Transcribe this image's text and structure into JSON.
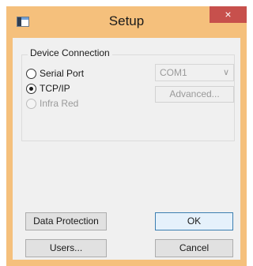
{
  "window": {
    "title": "Setup",
    "close_label": "×"
  },
  "device_connection": {
    "group_label": "Device Connection",
    "options": [
      {
        "label": "Serial Port",
        "selected": false,
        "enabled": true
      },
      {
        "label": "TCP/IP",
        "selected": true,
        "enabled": true
      },
      {
        "label": "Infra Red",
        "selected": false,
        "enabled": false
      }
    ],
    "port_select": {
      "value": "COM1",
      "enabled": false
    },
    "advanced_label": "Advanced..."
  },
  "buttons": {
    "data_protection": "Data Protection",
    "ok": "OK",
    "users": "Users...",
    "cancel": "Cancel"
  },
  "colors": {
    "title_bar": "#f5c07c",
    "close_button": "#c7504c",
    "default_button_border": "#3c7fb1"
  }
}
